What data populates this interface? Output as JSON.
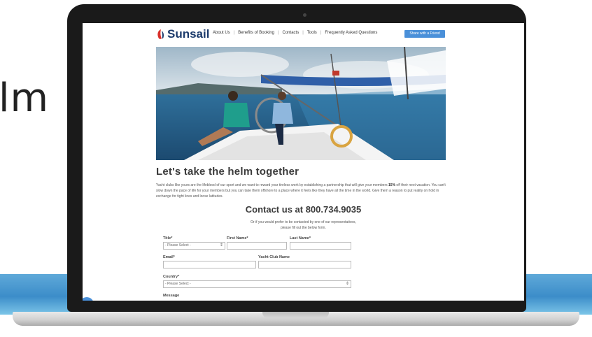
{
  "side_text": "lm",
  "site": {
    "logo": "Sunsail",
    "nav": [
      "About Us",
      "Benefits of Booking",
      "Contacts",
      "Tools",
      "Frequently Asked Questions"
    ],
    "share_button": "Share with a Friend"
  },
  "content": {
    "headline": "Let's take the helm together",
    "intro_start": "Yacht clubs like yours are the lifeblood of our sport and we want to reward your tireless work by establishing a partnership that will give your members ",
    "intro_bold": "15%",
    "intro_end": " off their next vacation. You can't slow down the pace of life for your members but you can take them offshore to a place where it feels like they have all the time in the world. Give them a reason to put reality on hold in exchange for tight lines and loose latitudes.",
    "contact_line": "Contact us at 800.734.9035",
    "sub_line1": "Or if you would prefer to be contacted by one of our representatives,",
    "sub_line2": "please fill out the below form."
  },
  "form": {
    "title_label": "Title*",
    "title_value": "- Please Select -",
    "first_name_label": "First Name*",
    "last_name_label": "Last Name*",
    "email_label": "Email*",
    "yacht_club_label": "Yacht Club Name",
    "country_label": "Country*",
    "country_value": "- Please Select -",
    "message_label": "Message"
  },
  "colors": {
    "brand_navy": "#1b3a6b",
    "brand_red": "#d9302b",
    "button_blue": "#4a90d9"
  }
}
